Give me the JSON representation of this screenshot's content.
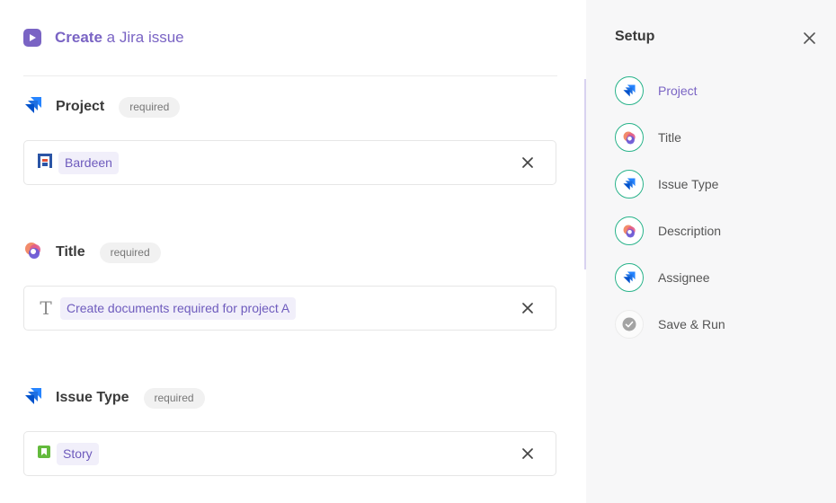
{
  "header": {
    "title_strong": "Create",
    "title_rest": "a Jira issue"
  },
  "fields": [
    {
      "label": "Project",
      "badge": "required",
      "value": "Bardeen",
      "value_icon": "bardeen-logo-icon"
    },
    {
      "label": "Title",
      "badge": "required",
      "value": "Create documents required for project A",
      "value_icon": "text-type-icon"
    },
    {
      "label": "Issue Type",
      "badge": "required",
      "value": "Story",
      "value_icon": "story-bookmark-icon"
    }
  ],
  "sidebar": {
    "title": "Setup",
    "steps": [
      {
        "label": "Project",
        "icon": "jira-icon",
        "state": "active"
      },
      {
        "label": "Title",
        "icon": "bardeen-icon",
        "state": "done"
      },
      {
        "label": "Issue Type",
        "icon": "jira-icon",
        "state": "done"
      },
      {
        "label": "Description",
        "icon": "bardeen-icon",
        "state": "done"
      },
      {
        "label": "Assignee",
        "icon": "jira-icon",
        "state": "done"
      },
      {
        "label": "Save & Run",
        "icon": "check-circle-icon",
        "state": "pending"
      }
    ]
  },
  "colors": {
    "accent": "#7a64c4",
    "chip_bg": "#f1effa",
    "jira_blue": "#2684ff",
    "step_done_ring": "#28b38a",
    "story_green": "#63ba3c"
  }
}
